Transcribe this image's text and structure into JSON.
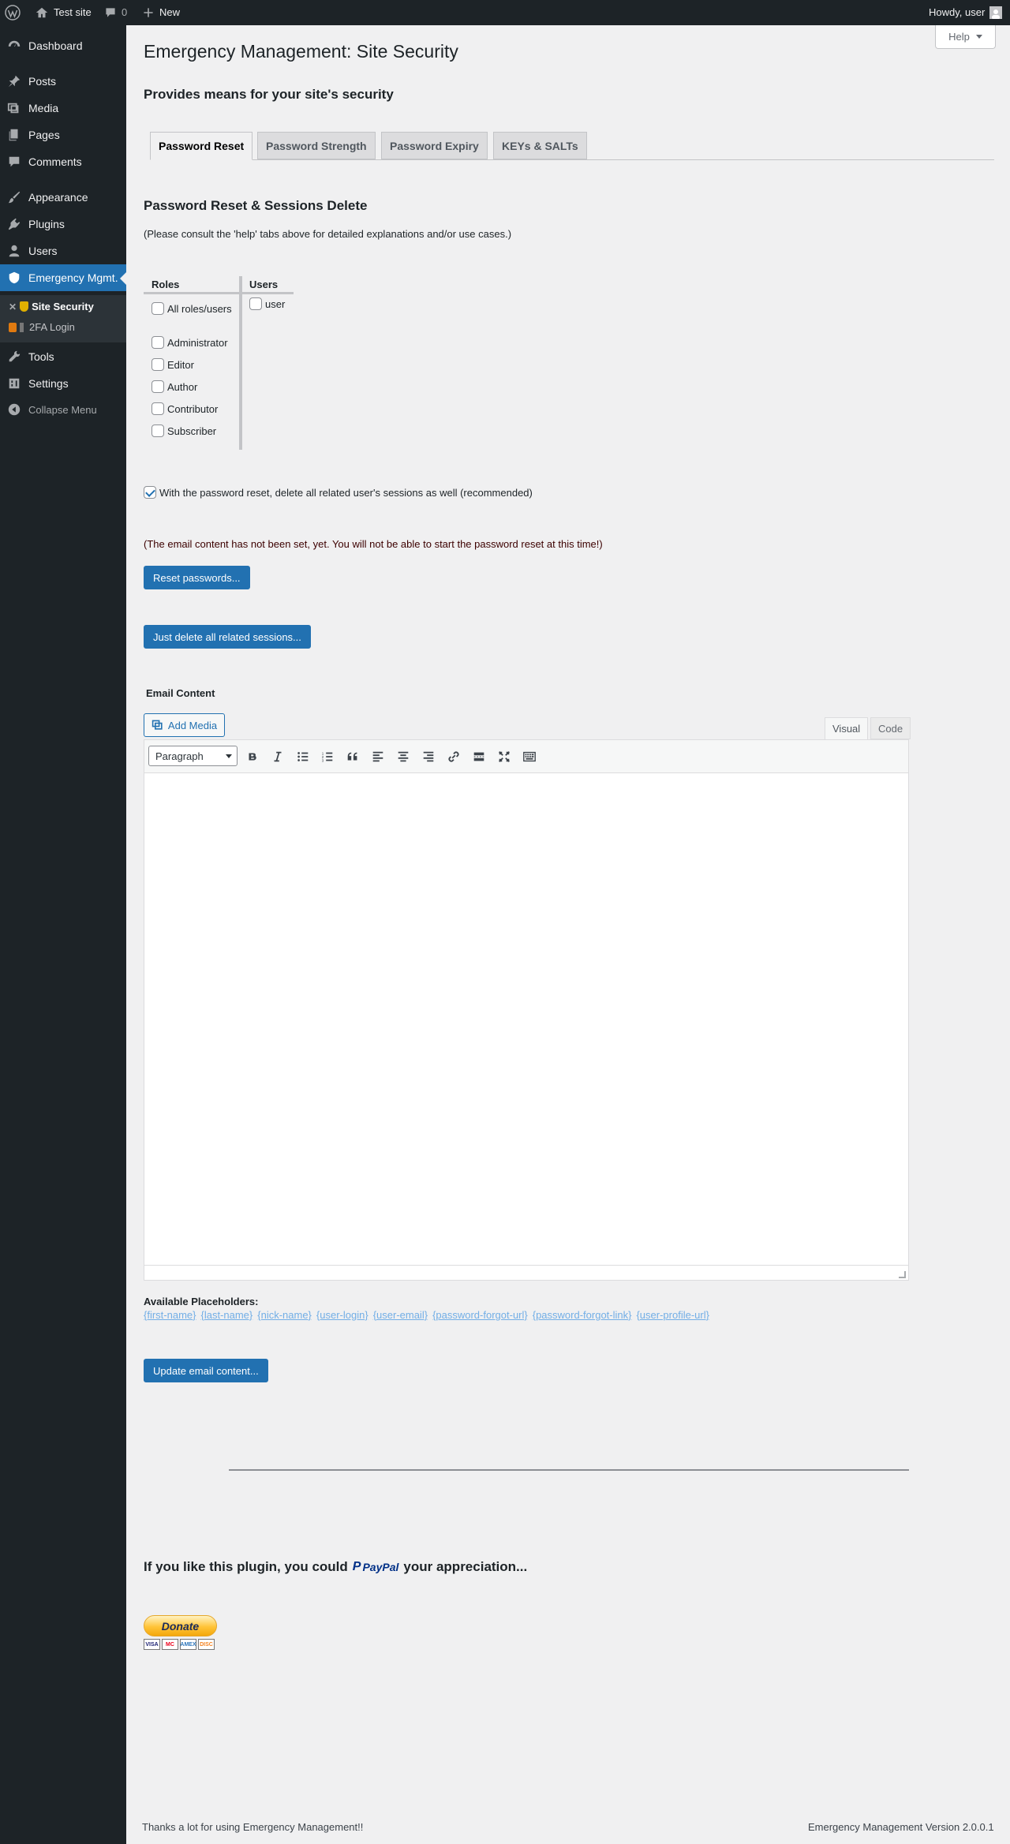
{
  "adminbar": {
    "site_name": "Test site",
    "comments_count": "0",
    "new_label": "New",
    "howdy": "Howdy, user"
  },
  "sidebar": {
    "items": [
      {
        "label": "Dashboard",
        "icon": "dashboard-icon"
      },
      {
        "label": "Posts",
        "icon": "pin-icon"
      },
      {
        "label": "Media",
        "icon": "media-icon"
      },
      {
        "label": "Pages",
        "icon": "pages-icon"
      },
      {
        "label": "Comments",
        "icon": "comment-icon"
      },
      {
        "label": "Appearance",
        "icon": "brush-icon"
      },
      {
        "label": "Plugins",
        "icon": "plugin-icon"
      },
      {
        "label": "Users",
        "icon": "user-icon"
      },
      {
        "label": "Emergency Mgmt.",
        "icon": "shield-icon"
      },
      {
        "label": "Tools",
        "icon": "wrench-icon"
      },
      {
        "label": "Settings",
        "icon": "settings-icon"
      }
    ],
    "submenu": [
      {
        "label": "Site Security"
      },
      {
        "label": "2FA Login"
      }
    ],
    "collapse_label": "Collapse Menu"
  },
  "page": {
    "title": "Emergency Management: Site Security",
    "help_label": "Help",
    "subtitle": "Provides means for your site's security",
    "tabs": [
      {
        "label": "Password Reset",
        "active": true
      },
      {
        "label": "Password Strength",
        "active": false
      },
      {
        "label": "Password Expiry",
        "active": false
      },
      {
        "label": "KEYs & SALTs",
        "active": false
      }
    ],
    "section_title": "Password Reset & Sessions Delete",
    "consult_text": "(Please consult the 'help' tabs above for detailed explanations and/or use cases.)",
    "roles_header": "Roles",
    "users_header": "Users",
    "roles": [
      "All roles/users",
      "Administrator",
      "Editor",
      "Author",
      "Contributor",
      "Subscriber"
    ],
    "users": [
      "user"
    ],
    "delete_sessions_label": "With the password reset, delete all related user's sessions as well (recommended)",
    "delete_sessions_checked": true,
    "notice": "(The email content has not been set, yet. You will not be able to start the password reset at this time!)",
    "reset_button": "Reset passwords...",
    "delete_sessions_button": "Just delete all related sessions...",
    "email_content_label": "Email Content",
    "add_media_label": "Add Media",
    "editor_tabs": {
      "visual": "Visual",
      "code": "Code"
    },
    "format_select": "Paragraph",
    "placeholders_title": "Available Placeholders:",
    "placeholders": [
      "{first-name}",
      "{last-name}",
      "{nick-name}",
      "{user-login}",
      "{user-email}",
      "{password-forgot-url}",
      "{password-forgot-link}",
      "{user-profile-url}"
    ],
    "update_button": "Update email content...",
    "appreciation_before": "If you like this plugin, you could",
    "appreciation_after": "your appreciation...",
    "paypal_brand": "PayPal",
    "donate_label": "Donate",
    "cards": [
      "VISA",
      "MC",
      "AMEX",
      "DISC"
    ]
  },
  "footer": {
    "left": "Thanks a lot for using Emergency Management!!",
    "right": "Emergency Management Version 2.0.0.1"
  },
  "colors": {
    "adminbar_bg": "#1d2327",
    "accent": "#2271b1",
    "notice": "#3c0000",
    "link": "#72aee6"
  }
}
